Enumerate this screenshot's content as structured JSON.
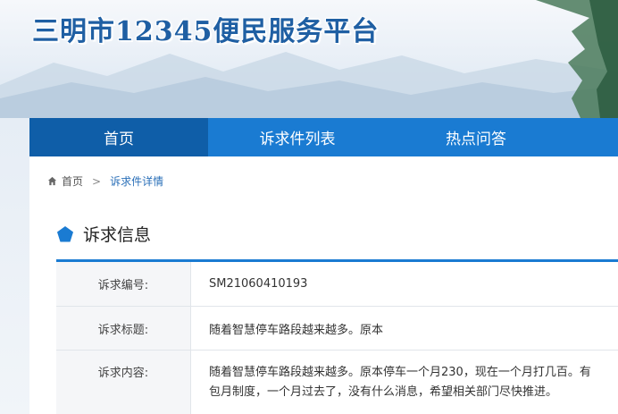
{
  "header": {
    "site_title": "三明市12345便民服务平台"
  },
  "nav": {
    "items": [
      "首页",
      "诉求件列表",
      "热点问答"
    ],
    "active_index": 0
  },
  "breadcrumb": {
    "home": "首页",
    "separator": ">",
    "current": "诉求件详情"
  },
  "section": {
    "title": "诉求信息"
  },
  "details": {
    "number_label": "诉求编号:",
    "number_value": "SM21060410193",
    "title_label": "诉求标题:",
    "title_value": "随着智慧停车路段越来越多。原本",
    "content_label": "诉求内容:",
    "content_line1": "随着智慧停车路段越来越多。原本停车一个月230，现在一个月打几百。有",
    "content_line2": "包月制度，一个月过去了，没有什么消息，希望相关部门尽快推进。"
  },
  "colors": {
    "accent": "#1a7bd2",
    "nav_active": "#0f5ea8",
    "title": "#1f5fa3"
  },
  "icons": [
    "home-icon",
    "chevron-right-icon",
    "pentagon-icon"
  ]
}
